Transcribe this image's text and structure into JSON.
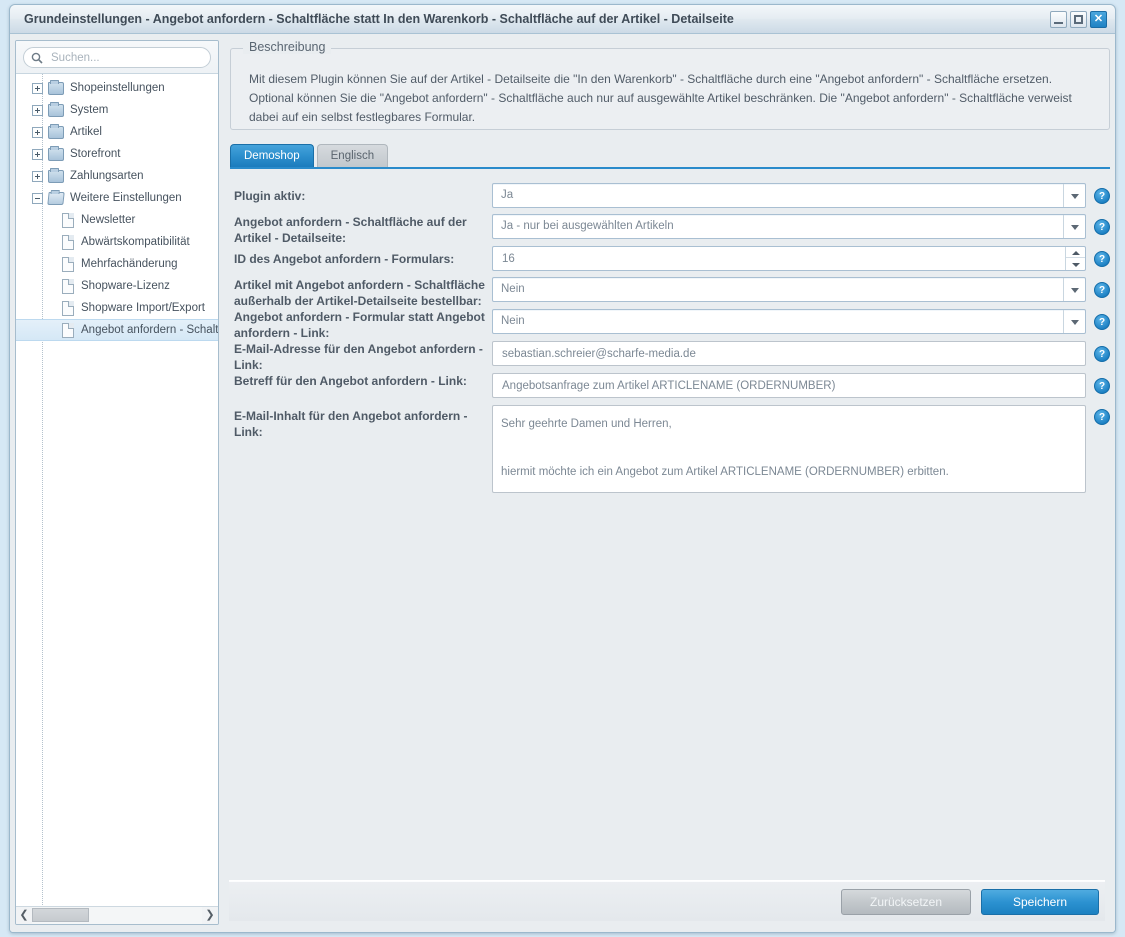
{
  "window": {
    "title": "Grundeinstellungen - Angebot anfordern - Schaltfläche statt In den Warenkorb - Schaltfläche auf der Artikel - Detailseite",
    "controls": {
      "minimize": "minimize-icon",
      "maximize": "maximize-icon",
      "close": "✕"
    },
    "accent_color": "#2a8bcb"
  },
  "sidebar": {
    "search": {
      "placeholder": "Suchen...",
      "value": "",
      "icon": "search-icon"
    },
    "tree": [
      {
        "label": "Shopeinstellungen",
        "level": 1,
        "type": "folder",
        "state": "collapsed",
        "selected": false
      },
      {
        "label": "System",
        "level": 1,
        "type": "folder",
        "state": "collapsed",
        "selected": false
      },
      {
        "label": "Artikel",
        "level": 1,
        "type": "folder",
        "state": "collapsed",
        "selected": false
      },
      {
        "label": "Storefront",
        "level": 1,
        "type": "folder",
        "state": "collapsed",
        "selected": false
      },
      {
        "label": "Zahlungsarten",
        "level": 1,
        "type": "folder",
        "state": "collapsed",
        "selected": false
      },
      {
        "label": "Weitere Einstellungen",
        "level": 1,
        "type": "folder",
        "state": "expanded",
        "selected": false
      },
      {
        "label": "Newsletter",
        "level": 2,
        "type": "leaf",
        "selected": false
      },
      {
        "label": "Abwärtskompatibilität",
        "level": 2,
        "type": "leaf",
        "selected": false
      },
      {
        "label": "Mehrfachänderung",
        "level": 2,
        "type": "leaf",
        "selected": false
      },
      {
        "label": "Shopware-Lizenz",
        "level": 2,
        "type": "leaf",
        "selected": false
      },
      {
        "label": "Shopware Import/Export",
        "level": 2,
        "type": "leaf",
        "selected": false
      },
      {
        "label": "Angebot anfordern - Schaltfläche",
        "level": 2,
        "type": "leaf",
        "selected": true
      }
    ],
    "scrollbar": {
      "left_arrow": "❮",
      "right_arrow": "❯"
    }
  },
  "description": {
    "legend": "Beschreibung",
    "text": "Mit diesem Plugin können Sie auf der Artikel - Detailseite die \"In den Warenkorb\" - Schaltfläche durch eine \"Angebot anfordern\" - Schaltfläche ersetzen. Optional können Sie die \"Angebot anfordern\" - Schaltfläche auch nur auf ausgewählte Artikel beschränken. Die \"Angebot anfordern\" - Schaltfläche verweist dabei auf ein selbst festlegbares Formular."
  },
  "tabs": [
    {
      "label": "Demoshop",
      "active": true
    },
    {
      "label": "Englisch",
      "active": false
    }
  ],
  "form": {
    "help_glyph": "?",
    "fields": [
      {
        "label": "Plugin aktiv:",
        "control": "dropdown",
        "value": "Ja"
      },
      {
        "label": "Angebot anfordern - Schaltfläche auf der Artikel - Detailseite:",
        "control": "dropdown",
        "value": "Ja - nur bei ausgewählten Artikeln"
      },
      {
        "label": "ID des Angebot anfordern - Formulars:",
        "control": "spinner",
        "value": "16"
      },
      {
        "label": "Artikel mit Angebot anfordern - Schaltfläche außerhalb der Artikel-Detailseite bestellbar:",
        "control": "dropdown",
        "value": "Nein"
      },
      {
        "label": "Angebot anfordern - Formular statt Angebot anfordern - Link:",
        "control": "dropdown",
        "value": "Nein"
      },
      {
        "label": "E-Mail-Adresse für den Angebot anfordern - Link:",
        "control": "text",
        "value": "sebastian.schreier@scharfe-media.de"
      },
      {
        "label": "Betreff für den Angebot anfordern - Link:",
        "control": "text",
        "value": "Angebotsanfrage zum Artikel ARTICLENAME (ORDERNUMBER)"
      },
      {
        "label": "E-Mail-Inhalt für den Angebot anfordern - Link:",
        "control": "textarea",
        "value": "Sehr geehrte Damen und Herren,\n\nhiermit möchte ich ein Angebot zum Artikel ARTICLENAME (ORDERNUMBER) erbitten.\n\nMit freundlichen Grüßen"
      }
    ]
  },
  "footer": {
    "reset_label": "Zurücksetzen",
    "save_label": "Speichern"
  }
}
